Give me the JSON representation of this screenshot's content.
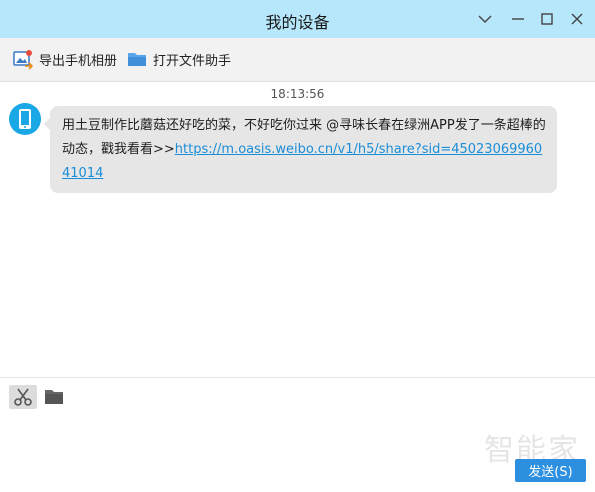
{
  "window": {
    "title": "我的设备",
    "controls": [
      "chevron-down-icon",
      "minimize-icon",
      "maximize-icon",
      "close-icon"
    ]
  },
  "toolbar": {
    "export_label": "导出手机相册",
    "export_icon": "photo-export-icon",
    "open_label": "打开文件助手",
    "open_icon": "folder-icon"
  },
  "chat": {
    "timestamp": "18:13:56",
    "message": {
      "avatar_icon": "phone-icon",
      "text": "用土豆制作比蘑菇还好吃的菜，不好吃你过来 @寻味长春在绿洲APP发了一条超棒的动态，戳我看看>>",
      "link": "https://m.oasis.weibo.cn/v1/h5/share?sid=4502306996041014"
    }
  },
  "input": {
    "tools": [
      "scissors-icon",
      "folder-icon"
    ],
    "value": "",
    "send_label": "发送(S)"
  },
  "watermark": "智能家",
  "colors": {
    "titlebar": "#b6e7fb",
    "toolbar": "#f2f2f2",
    "bubble": "#e6e6e6",
    "link": "#1a8ed8",
    "avatar": "#1aa7e6",
    "send_button": "#2d8fe0"
  }
}
